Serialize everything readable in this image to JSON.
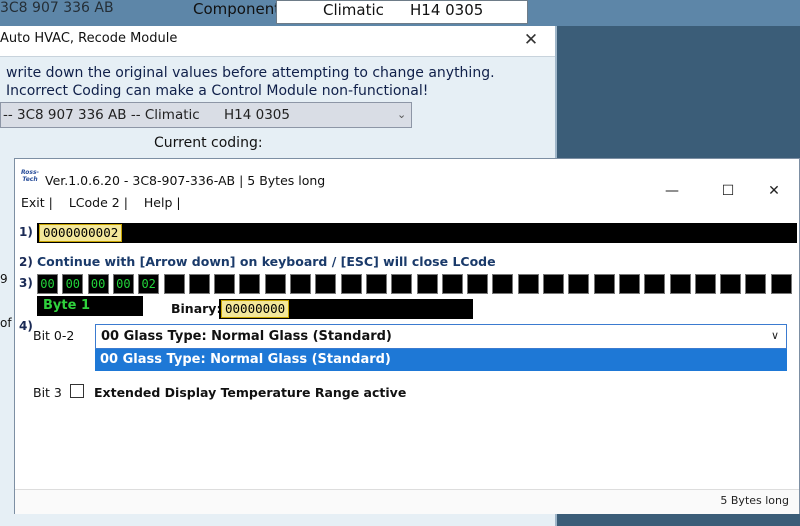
{
  "background": {
    "partial_part_number": "3C8 907 336 AB",
    "component_label": "Component:",
    "component_value": "Climatic",
    "component_version": "H14 0305",
    "recode_title": "Auto HVAC,  Recode Module",
    "warning_line1": "write down the original values before attempting to change anything.",
    "warning_line2": "Incorrect Coding can make a Control Module non-functional!",
    "module_select_text": "-- 3C8 907 336 AB -- Climatic",
    "module_select_version": "H14 0305",
    "current_coding_label": "Current coding:",
    "edge_fragment_1": "9",
    "edge_fragment_2": "of"
  },
  "lcode": {
    "logo_text": "Ross-Tech",
    "title": "Ver.1.0.6.20 -   3C8-907-336-AB | 5 Bytes long",
    "menu": [
      "Exit |",
      "LCode 2 |",
      "Help |"
    ],
    "row1": "1)",
    "coding_value": "0000000002",
    "row2": "2)",
    "instruction": "Continue with [Arrow down] on keyboard / [ESC] will close LCode",
    "row3": "3)",
    "bytes": [
      "00",
      "00",
      "00",
      "00",
      "02"
    ],
    "empty_byte_count": 25,
    "byte_label": "Byte 1",
    "binary_label": "Binary:",
    "binary_value": "00000000",
    "row4": "4)",
    "bit02_label": "Bit 0-2",
    "bit02_selected": "00 Glass Type: Normal Glass (Standard)",
    "bit02_highlighted_option": "00 Glass Type: Normal Glass (Standard)",
    "bit3_label": "Bit 3",
    "bit3_text": "Extended Display Temperature Range active",
    "bit3_checked": false,
    "status": "5 Bytes long"
  },
  "colors": {
    "byte_text": "#22d33a",
    "highlight": "#1e78d6",
    "field_value_bg": "#f3e79a"
  }
}
